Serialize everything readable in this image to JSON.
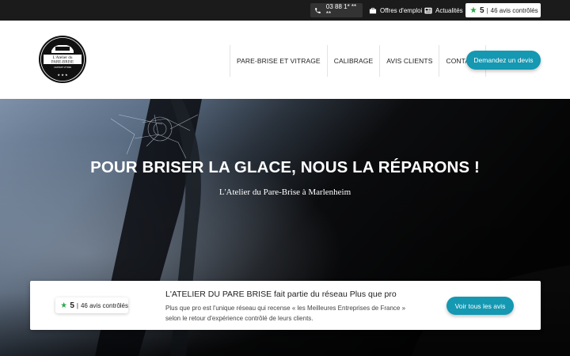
{
  "topbar": {
    "phone": "03 88 1* ** **",
    "jobs_label": "Offres d'emploi",
    "news_label": "Actualités",
    "rating": {
      "score": "5",
      "separator": "|",
      "count_label": "46 avis contrôlés"
    }
  },
  "header": {
    "logo": {
      "line1": "L'Atelier du",
      "line2": "PARE-BRISE",
      "tagline": "L'EXPERT VITRES",
      "stars": "★ ★ ★"
    },
    "nav": [
      {
        "label": "PARE-BRISE ET VITRAGE"
      },
      {
        "label": "CALIBRAGE"
      },
      {
        "label": "AVIS CLIENTS"
      },
      {
        "label": "CONTACT"
      }
    ],
    "cta_label": "Demandez un devis"
  },
  "hero": {
    "title": "POUR BRISER LA GLACE, NOUS LA RÉPARONS !",
    "subtitle": "L'Atelier du Pare-Brise à Marlenheim"
  },
  "review_card": {
    "badge": {
      "score": "5",
      "separator": "|",
      "count_label": "46 avis contrôlés"
    },
    "title": "L'ATELIER DU PARE BRISE fait partie du réseau Plus que pro",
    "description": "Plus que pro est l'unique réseau qui recense « les Meilleures Entreprises de France » selon le retour d'expérience contrôlé de leurs clients.",
    "button_label": "Voir tous les avis"
  },
  "colors": {
    "accent": "#1598b2",
    "topbar_bg": "#1b1b1b",
    "rating_green": "#2aa84a"
  }
}
